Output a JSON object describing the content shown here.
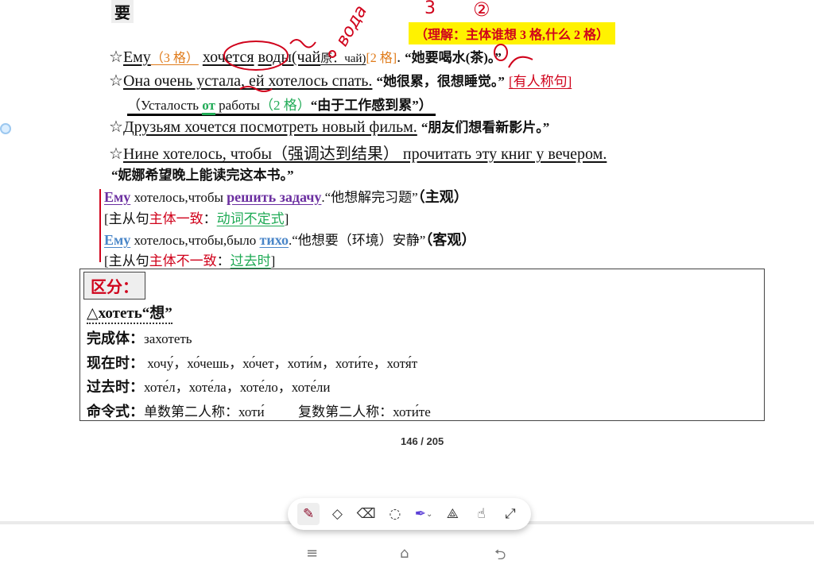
{
  "header_char": "要",
  "hint": "（理解：主体谁想 3 格,什么 2 格）",
  "l1": {
    "star": "☆",
    "a": "Ему",
    "b": "（3 格）",
    "c": "хочется",
    "d": "воды(чай",
    "e": "原：чай)",
    "f": "[2 格]",
    "g": ".",
    "h": "“她要喝水(茶)。”"
  },
  "l2": {
    "star": "☆",
    "a": "Она очень устала, ей хотелось спать.",
    "b": "“她很累，很想睡觉。”",
    "c": "[有人称句]"
  },
  "l3": {
    "a": "（Усталость ",
    "b": "от",
    "c": " работы",
    "d": "（2 格）",
    "e": "“由于工作感到累”）"
  },
  "l4": {
    "star": "☆",
    "a": "Друзьям хочется посмотреть новый фильм.",
    "b": "“朋友们想看新影片。”"
  },
  "l5": {
    "star": "☆",
    "a": "Нине хотелось, чтобы（强调达到结果） прочитать эту книг у вечером."
  },
  "l6": "“妮娜希望晚上能读完这本书。”",
  "e1": {
    "a": "Ему",
    "b": " хотелось,чтобы ",
    "c": "решить задачу",
    "d": ".“他想解完习题”",
    "e": "（主观）"
  },
  "e2": {
    "a": "[主从句",
    "b": "主体一致",
    "c": "：",
    "d": "动词不定式",
    "e": "]"
  },
  "e3": {
    "a": "Ему",
    "b": " хотелось,чтобы,было ",
    "c": "тихо",
    "d": ".“他想要（环境）安静”",
    "e": "（客观）"
  },
  "e4": {
    "a": "[主从句",
    "b": "主体不一致",
    "c": "：",
    "d": "过去时",
    "e": "]"
  },
  "box": {
    "title": "区分：",
    "heading": "△хотеть“想”",
    "rows": [
      {
        "label": "完成体：",
        "value": "захотеть"
      },
      {
        "label": "现在时：",
        "value": " хочу́，хо́чешь，хо́чет，хоти́м，хоти́те，хотя́т"
      },
      {
        "label": "过去时：",
        "value": "хоте́л，хоте́ла，хоте́ло，хоте́ли"
      },
      {
        "label": "命令式：",
        "value": "单数第二人称：хоти́          复数第二人称：хоти́те"
      }
    ]
  },
  "page_indicator": "146 / 205",
  "annotations": {
    "a": "3",
    "b": "②",
    "c": "вода"
  },
  "toolbar": {
    "pencil": "✎",
    "highlighter": "◇",
    "eraser": "⌫",
    "lasso": "◌",
    "pen": "✒",
    "more": "⌄",
    "shape": "⟁",
    "hand": "☝",
    "expand": "⤢"
  },
  "nav": {
    "menu": "≡",
    "home": "⌂",
    "back": "⮌"
  }
}
